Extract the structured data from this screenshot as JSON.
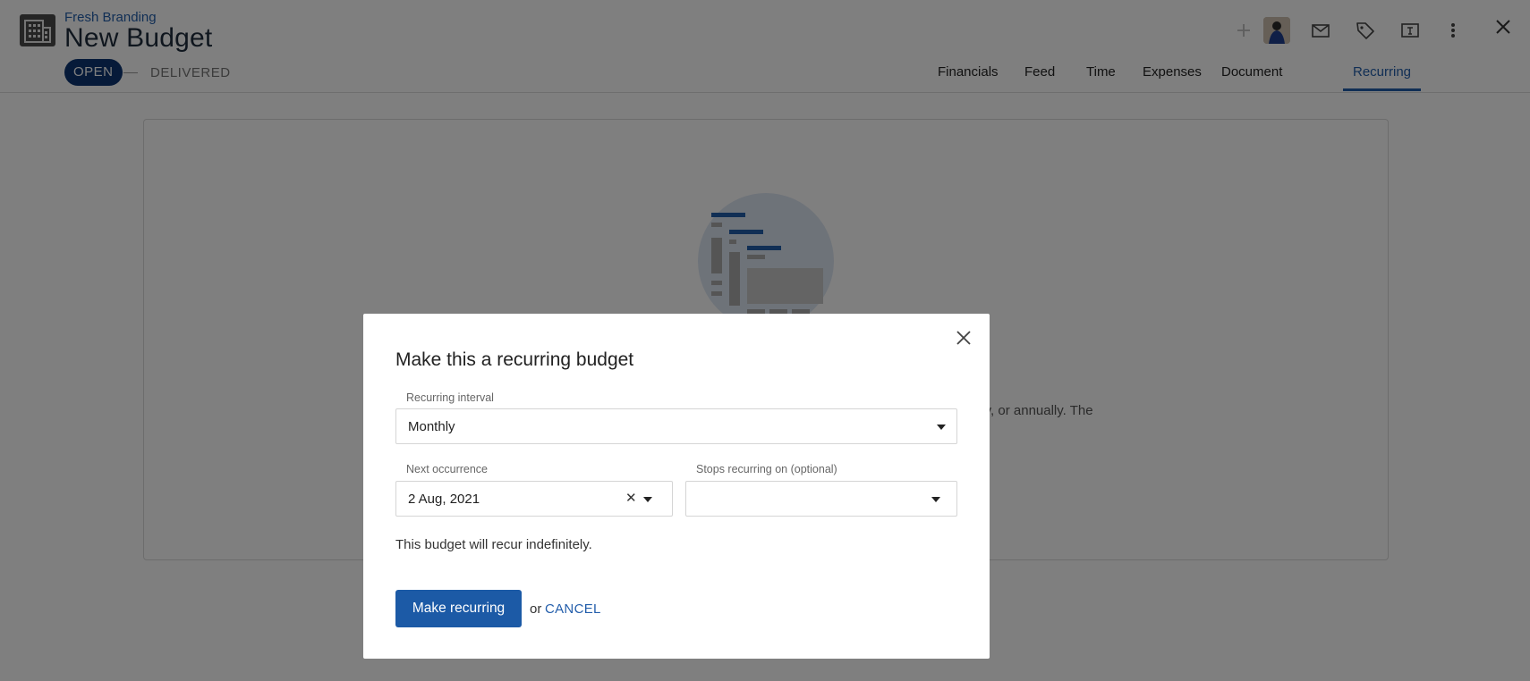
{
  "header": {
    "client_name": "Fresh Branding",
    "title": "New Budget",
    "stages": {
      "open": "OPEN",
      "delivered": "DELIVERED"
    },
    "tabs": [
      {
        "label": "Financials"
      },
      {
        "label": "Feed"
      },
      {
        "label": "Time"
      },
      {
        "label": "Expenses"
      },
      {
        "label": "Document"
      },
      {
        "label": "Recurring",
        "active": true
      }
    ],
    "icons": [
      "plus-icon",
      "avatar",
      "mail-icon",
      "tag-icon",
      "text-field-icon",
      "more-vertical-icon",
      "close-icon"
    ]
  },
  "background": {
    "partial_text": "lly, or annually. The"
  },
  "modal": {
    "title": "Make this a recurring budget",
    "interval": {
      "label": "Recurring interval",
      "value": "Monthly"
    },
    "next_occurrence": {
      "label": "Next occurrence",
      "value": "2 Aug, 2021"
    },
    "stops_on": {
      "label": "Stops recurring on (optional)",
      "value": ""
    },
    "note": "This budget will recur indefinitely.",
    "submit_label": "Make recurring",
    "or_text": "or",
    "cancel_label": "CANCEL"
  },
  "colors": {
    "primary": "#1c5aa6",
    "stage_open": "#0c3573",
    "link": "#235eab",
    "overlay": "rgba(0,0,0,0.5)"
  }
}
